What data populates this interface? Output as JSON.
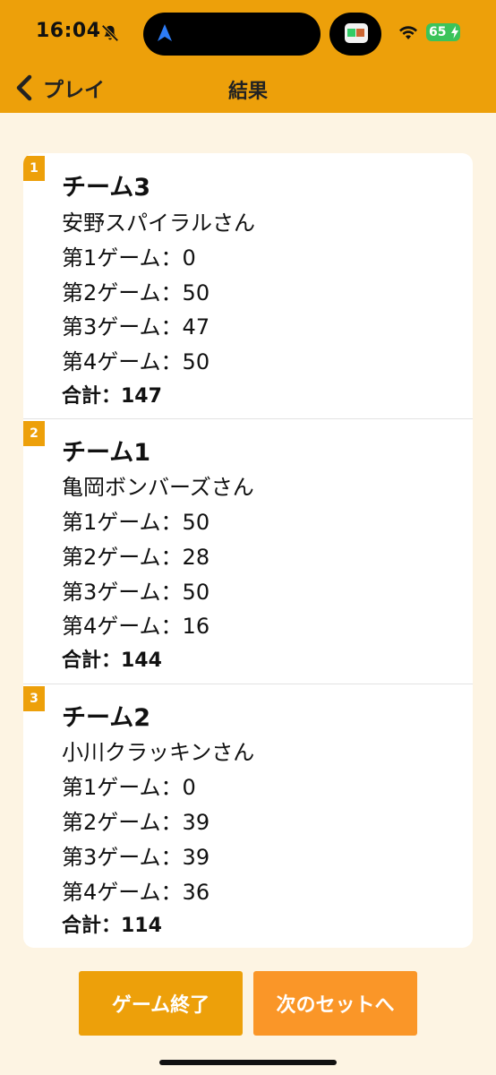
{
  "status_bar": {
    "time": "16:04",
    "battery": "65",
    "icons": [
      "bell-slash-icon",
      "location-arrow-icon",
      "wifi-icon",
      "battery-charging-icon"
    ]
  },
  "nav": {
    "back_label": "プレイ",
    "title": "結果"
  },
  "results": [
    {
      "rank": "1",
      "team": "チーム3",
      "member": "安野スパイラルさん",
      "games": [
        "第1ゲーム：0",
        "第2ゲーム：50",
        "第3ゲーム：47",
        "第4ゲーム：50"
      ],
      "total": "合計：147"
    },
    {
      "rank": "2",
      "team": "チーム1",
      "member": "亀岡ボンバーズさん",
      "games": [
        "第1ゲーム：50",
        "第2ゲーム：28",
        "第3ゲーム：50",
        "第4ゲーム：16"
      ],
      "total": "合計：144"
    },
    {
      "rank": "3",
      "team": "チーム2",
      "member": "小川クラッキンさん",
      "games": [
        "第1ゲーム：0",
        "第2ゲーム：39",
        "第3ゲーム：39",
        "第4ゲーム：36"
      ],
      "total": "合計：114"
    }
  ],
  "buttons": {
    "end_game": "ゲーム終了",
    "next_set": "次のセットへ"
  },
  "colors": {
    "accent": "#EDA00A",
    "accent_secondary": "#FA9628",
    "background": "#FDF4E3"
  }
}
